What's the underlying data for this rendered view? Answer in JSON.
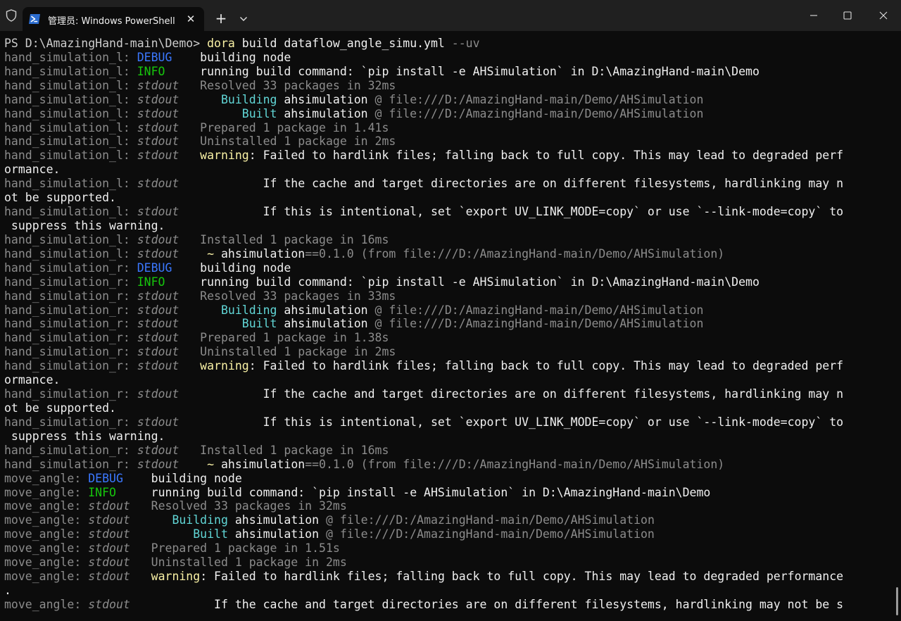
{
  "titlebar": {
    "tab_title": "管理员: Windows PowerShell",
    "icons": {
      "shield": "shield-icon",
      "tab": "powershell-icon",
      "close_tab": "close-icon",
      "new_tab": "plus-icon",
      "dropdown": "chevron-down-icon",
      "minimize": "minimize-icon",
      "maximize": "maximize-icon",
      "close_window": "close-icon"
    },
    "close_glyph": "✕",
    "plus_glyph": "+"
  },
  "colors": {
    "background": "#0c0c0c",
    "titlebar": "#202020",
    "debug": "#3b78ff",
    "info": "#16c60c",
    "warning": "#f9f1a5",
    "cyan": "#61d6d6",
    "gray": "#8c8c8c"
  },
  "terminal": {
    "lines": [
      [
        {
          "t": "PS D:\\AmazingHand-main\\Demo> ",
          "c": "prompt"
        },
        {
          "t": "dora",
          "c": "cmd"
        },
        {
          "t": " build dataflow_angle_simu.yml ",
          "c": "white"
        },
        {
          "t": "--uv",
          "c": "gray"
        }
      ],
      [
        {
          "t": "hand_simulation_l: ",
          "c": "gray"
        },
        {
          "t": "DEBUG",
          "c": "debug"
        },
        {
          "t": "    building node",
          "c": "white"
        }
      ],
      [
        {
          "t": "hand_simulation_l: ",
          "c": "gray"
        },
        {
          "t": "INFO",
          "c": "info"
        },
        {
          "t": "     running build command: `pip install -e AHSimulation` in D:\\AmazingHand-main\\Demo",
          "c": "white"
        }
      ],
      [
        {
          "t": "hand_simulation_l: ",
          "c": "gray"
        },
        {
          "t": "stdout",
          "c": "stdout"
        },
        {
          "t": "   Resolved 33 packages in 32ms",
          "c": "gray"
        }
      ],
      [
        {
          "t": "hand_simulation_l: ",
          "c": "gray"
        },
        {
          "t": "stdout",
          "c": "stdout"
        },
        {
          "t": "      ",
          "c": "gray"
        },
        {
          "t": "Building",
          "c": "cyan"
        },
        {
          "t": " ahsimulation",
          "c": "white"
        },
        {
          "t": " @ file:///D:/AmazingHand-main/Demo/AHSimulation",
          "c": "gray"
        }
      ],
      [
        {
          "t": "hand_simulation_l: ",
          "c": "gray"
        },
        {
          "t": "stdout",
          "c": "stdout"
        },
        {
          "t": "         ",
          "c": "gray"
        },
        {
          "t": "Built",
          "c": "cyan"
        },
        {
          "t": " ahsimulation",
          "c": "white"
        },
        {
          "t": " @ file:///D:/AmazingHand-main/Demo/AHSimulation",
          "c": "gray"
        }
      ],
      [
        {
          "t": "hand_simulation_l: ",
          "c": "gray"
        },
        {
          "t": "stdout",
          "c": "stdout"
        },
        {
          "t": "   Prepared 1 package in 1.41s",
          "c": "gray"
        }
      ],
      [
        {
          "t": "hand_simulation_l: ",
          "c": "gray"
        },
        {
          "t": "stdout",
          "c": "stdout"
        },
        {
          "t": "   Uninstalled 1 package in 2ms",
          "c": "gray"
        }
      ],
      [
        {
          "t": "hand_simulation_l: ",
          "c": "gray"
        },
        {
          "t": "stdout",
          "c": "stdout"
        },
        {
          "t": "   ",
          "c": "gray"
        },
        {
          "t": "warning",
          "c": "yellow"
        },
        {
          "t": ": Failed to hardlink files; falling back to full copy. This may lead to degraded perf",
          "c": "white"
        }
      ],
      [
        {
          "t": "ormance.",
          "c": "white"
        }
      ],
      [
        {
          "t": "hand_simulation_l: ",
          "c": "gray"
        },
        {
          "t": "stdout",
          "c": "stdout"
        },
        {
          "t": "            If the cache and target directories are on different filesystems, hardlinking may n",
          "c": "white"
        }
      ],
      [
        {
          "t": "ot be supported.",
          "c": "white"
        }
      ],
      [
        {
          "t": "hand_simulation_l: ",
          "c": "gray"
        },
        {
          "t": "stdout",
          "c": "stdout"
        },
        {
          "t": "            If this is intentional, set `export UV_LINK_MODE=copy` or use `--link-mode=copy` to",
          "c": "white"
        }
      ],
      [
        {
          "t": " suppress this warning.",
          "c": "white"
        }
      ],
      [
        {
          "t": "hand_simulation_l: ",
          "c": "gray"
        },
        {
          "t": "stdout",
          "c": "stdout"
        },
        {
          "t": "   Installed 1 package in 16ms",
          "c": "gray"
        }
      ],
      [
        {
          "t": "hand_simulation_l: ",
          "c": "gray"
        },
        {
          "t": "stdout",
          "c": "stdout"
        },
        {
          "t": "    ",
          "c": "gray"
        },
        {
          "t": "~",
          "c": "yellow"
        },
        {
          "t": " ahsimulation",
          "c": "white"
        },
        {
          "t": "==0.1.0 (from file:///D:/AmazingHand-main/Demo/AHSimulation)",
          "c": "gray"
        }
      ],
      [
        {
          "t": "hand_simulation_r: ",
          "c": "gray"
        },
        {
          "t": "DEBUG",
          "c": "debug"
        },
        {
          "t": "    building node",
          "c": "white"
        }
      ],
      [
        {
          "t": "hand_simulation_r: ",
          "c": "gray"
        },
        {
          "t": "INFO",
          "c": "info"
        },
        {
          "t": "     running build command: `pip install -e AHSimulation` in D:\\AmazingHand-main\\Demo",
          "c": "white"
        }
      ],
      [
        {
          "t": "hand_simulation_r: ",
          "c": "gray"
        },
        {
          "t": "stdout",
          "c": "stdout"
        },
        {
          "t": "   Resolved 33 packages in 33ms",
          "c": "gray"
        }
      ],
      [
        {
          "t": "hand_simulation_r: ",
          "c": "gray"
        },
        {
          "t": "stdout",
          "c": "stdout"
        },
        {
          "t": "      ",
          "c": "gray"
        },
        {
          "t": "Building",
          "c": "cyan"
        },
        {
          "t": " ahsimulation",
          "c": "white"
        },
        {
          "t": " @ file:///D:/AmazingHand-main/Demo/AHSimulation",
          "c": "gray"
        }
      ],
      [
        {
          "t": "hand_simulation_r: ",
          "c": "gray"
        },
        {
          "t": "stdout",
          "c": "stdout"
        },
        {
          "t": "         ",
          "c": "gray"
        },
        {
          "t": "Built",
          "c": "cyan"
        },
        {
          "t": " ahsimulation",
          "c": "white"
        },
        {
          "t": " @ file:///D:/AmazingHand-main/Demo/AHSimulation",
          "c": "gray"
        }
      ],
      [
        {
          "t": "hand_simulation_r: ",
          "c": "gray"
        },
        {
          "t": "stdout",
          "c": "stdout"
        },
        {
          "t": "   Prepared 1 package in 1.38s",
          "c": "gray"
        }
      ],
      [
        {
          "t": "hand_simulation_r: ",
          "c": "gray"
        },
        {
          "t": "stdout",
          "c": "stdout"
        },
        {
          "t": "   Uninstalled 1 package in 2ms",
          "c": "gray"
        }
      ],
      [
        {
          "t": "hand_simulation_r: ",
          "c": "gray"
        },
        {
          "t": "stdout",
          "c": "stdout"
        },
        {
          "t": "   ",
          "c": "gray"
        },
        {
          "t": "warning",
          "c": "yellow"
        },
        {
          "t": ": Failed to hardlink files; falling back to full copy. This may lead to degraded perf",
          "c": "white"
        }
      ],
      [
        {
          "t": "ormance.",
          "c": "white"
        }
      ],
      [
        {
          "t": "hand_simulation_r: ",
          "c": "gray"
        },
        {
          "t": "stdout",
          "c": "stdout"
        },
        {
          "t": "            If the cache and target directories are on different filesystems, hardlinking may n",
          "c": "white"
        }
      ],
      [
        {
          "t": "ot be supported.",
          "c": "white"
        }
      ],
      [
        {
          "t": "hand_simulation_r: ",
          "c": "gray"
        },
        {
          "t": "stdout",
          "c": "stdout"
        },
        {
          "t": "            If this is intentional, set `export UV_LINK_MODE=copy` or use `--link-mode=copy` to",
          "c": "white"
        }
      ],
      [
        {
          "t": " suppress this warning.",
          "c": "white"
        }
      ],
      [
        {
          "t": "hand_simulation_r: ",
          "c": "gray"
        },
        {
          "t": "stdout",
          "c": "stdout"
        },
        {
          "t": "   Installed 1 package in 16ms",
          "c": "gray"
        }
      ],
      [
        {
          "t": "hand_simulation_r: ",
          "c": "gray"
        },
        {
          "t": "stdout",
          "c": "stdout"
        },
        {
          "t": "    ",
          "c": "gray"
        },
        {
          "t": "~",
          "c": "yellow"
        },
        {
          "t": " ahsimulation",
          "c": "white"
        },
        {
          "t": "==0.1.0 (from file:///D:/AmazingHand-main/Demo/AHSimulation)",
          "c": "gray"
        }
      ],
      [
        {
          "t": "move_angle: ",
          "c": "gray"
        },
        {
          "t": "DEBUG",
          "c": "debug"
        },
        {
          "t": "    building node",
          "c": "white"
        }
      ],
      [
        {
          "t": "move_angle: ",
          "c": "gray"
        },
        {
          "t": "INFO",
          "c": "info"
        },
        {
          "t": "     running build command: `pip install -e AHSimulation` in D:\\AmazingHand-main\\Demo",
          "c": "white"
        }
      ],
      [
        {
          "t": "move_angle: ",
          "c": "gray"
        },
        {
          "t": "stdout",
          "c": "stdout"
        },
        {
          "t": "   Resolved 33 packages in 32ms",
          "c": "gray"
        }
      ],
      [
        {
          "t": "move_angle: ",
          "c": "gray"
        },
        {
          "t": "stdout",
          "c": "stdout"
        },
        {
          "t": "      ",
          "c": "gray"
        },
        {
          "t": "Building",
          "c": "cyan"
        },
        {
          "t": " ahsimulation",
          "c": "white"
        },
        {
          "t": " @ file:///D:/AmazingHand-main/Demo/AHSimulation",
          "c": "gray"
        }
      ],
      [
        {
          "t": "move_angle: ",
          "c": "gray"
        },
        {
          "t": "stdout",
          "c": "stdout"
        },
        {
          "t": "         ",
          "c": "gray"
        },
        {
          "t": "Built",
          "c": "cyan"
        },
        {
          "t": " ahsimulation",
          "c": "white"
        },
        {
          "t": " @ file:///D:/AmazingHand-main/Demo/AHSimulation",
          "c": "gray"
        }
      ],
      [
        {
          "t": "move_angle: ",
          "c": "gray"
        },
        {
          "t": "stdout",
          "c": "stdout"
        },
        {
          "t": "   Prepared 1 package in 1.51s",
          "c": "gray"
        }
      ],
      [
        {
          "t": "move_angle: ",
          "c": "gray"
        },
        {
          "t": "stdout",
          "c": "stdout"
        },
        {
          "t": "   Uninstalled 1 package in 2ms",
          "c": "gray"
        }
      ],
      [
        {
          "t": "move_angle: ",
          "c": "gray"
        },
        {
          "t": "stdout",
          "c": "stdout"
        },
        {
          "t": "   ",
          "c": "gray"
        },
        {
          "t": "warning",
          "c": "yellow"
        },
        {
          "t": ": Failed to hardlink files; falling back to full copy. This may lead to degraded performance",
          "c": "white"
        }
      ],
      [
        {
          "t": ".",
          "c": "white"
        }
      ],
      [
        {
          "t": "move_angle: ",
          "c": "gray"
        },
        {
          "t": "stdout",
          "c": "stdout"
        },
        {
          "t": "            If the cache and target directories are on different filesystems, hardlinking may not be s",
          "c": "white"
        }
      ]
    ]
  }
}
